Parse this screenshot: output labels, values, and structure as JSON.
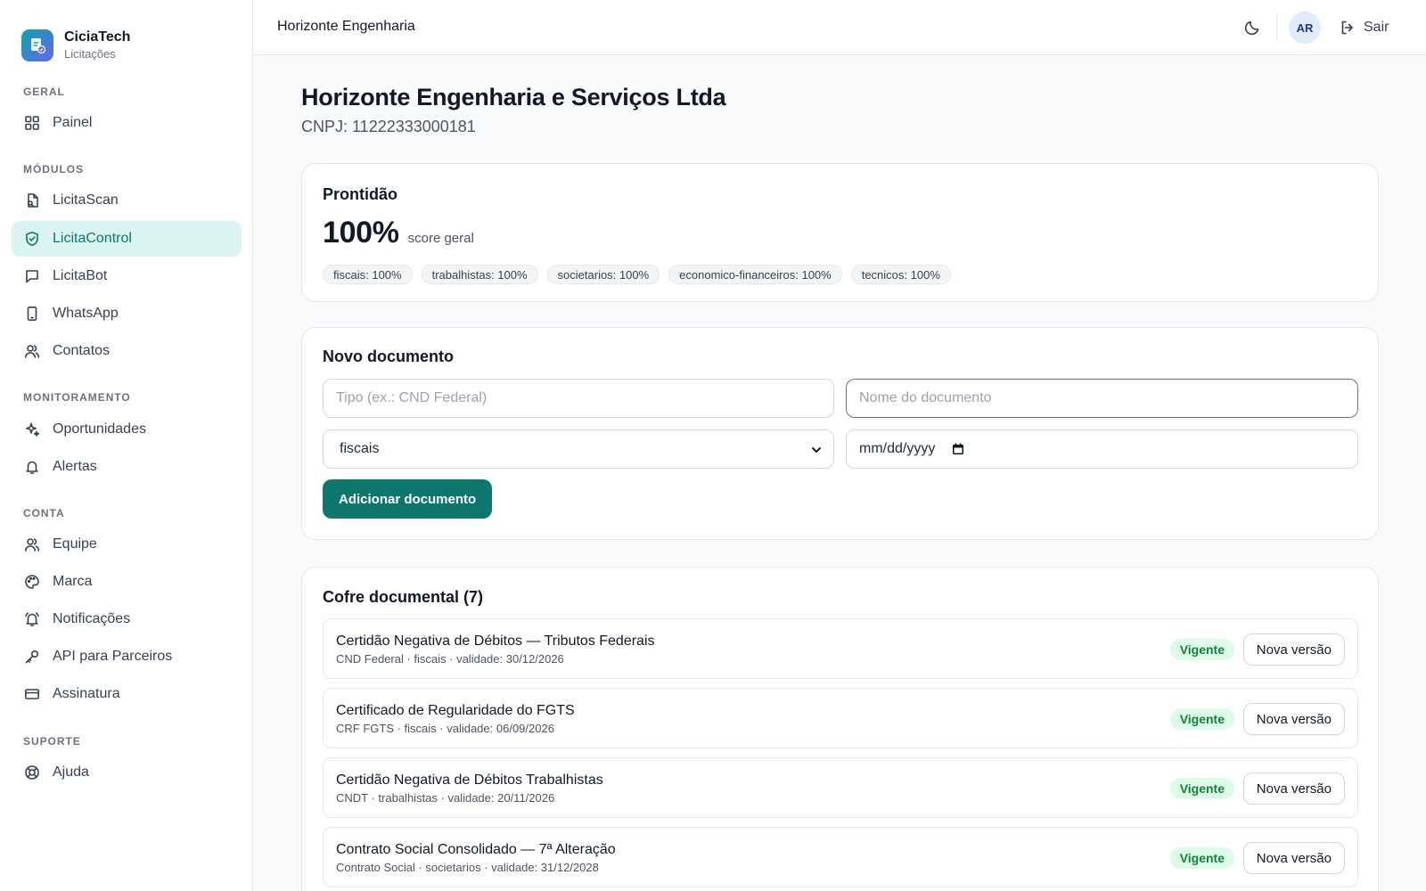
{
  "brand": {
    "name": "CiciaTech",
    "subtitle": "Licitações"
  },
  "sidebar": {
    "sections": [
      {
        "label": "GERAL"
      },
      {
        "label": "MÓDULOS"
      },
      {
        "label": "MONITORAMENTO"
      },
      {
        "label": "CONTA"
      },
      {
        "label": "SUPORTE"
      }
    ],
    "items": [
      {
        "label": "Painel",
        "icon": "grid-icon",
        "active": false
      },
      {
        "label": "LicitaScan",
        "icon": "file-scan-icon",
        "active": false
      },
      {
        "label": "LicitaControl",
        "icon": "shield-check-icon",
        "active": true
      },
      {
        "label": "LicitaBot",
        "icon": "chat-icon",
        "active": false
      },
      {
        "label": "WhatsApp",
        "icon": "phone-icon",
        "active": false
      },
      {
        "label": "Contatos",
        "icon": "users-icon",
        "active": false
      },
      {
        "label": "Oportunidades",
        "icon": "sparkles-icon",
        "active": false
      },
      {
        "label": "Alertas",
        "icon": "bell-icon",
        "active": false
      },
      {
        "label": "Equipe",
        "icon": "users-icon",
        "active": false
      },
      {
        "label": "Marca",
        "icon": "palette-icon",
        "active": false
      },
      {
        "label": "Notificações",
        "icon": "bell-ring-icon",
        "active": false
      },
      {
        "label": "API para Parceiros",
        "icon": "key-icon",
        "active": false
      },
      {
        "label": "Assinatura",
        "icon": "credit-card-icon",
        "active": false
      },
      {
        "label": "Ajuda",
        "icon": "lifebuoy-icon",
        "active": false
      }
    ]
  },
  "header": {
    "title": "Horizonte Engenharia",
    "avatar_initials": "AR",
    "logout_label": "Sair"
  },
  "company": {
    "name": "Horizonte Engenharia e Serviços Ltda",
    "cnpj": "CNPJ: 11222333000181"
  },
  "readiness": {
    "title": "Prontidão",
    "score": "100%",
    "score_label": "score geral",
    "chips": [
      "fiscais: 100%",
      "trabalhistas: 100%",
      "societarios: 100%",
      "economico-financeiros: 100%",
      "tecnicos: 100%"
    ]
  },
  "new_doc": {
    "title": "Novo documento",
    "type_placeholder": "Tipo (ex.: CND Federal)",
    "name_placeholder": "Nome do documento",
    "category_value": "fiscais",
    "date_placeholder": "mm/dd/yyyy",
    "submit_label": "Adicionar documento"
  },
  "vault": {
    "title": "Cofre documental (7)",
    "status_color": "#15803d",
    "docs": [
      {
        "title": "Certidão Negativa de Débitos — Tributos Federais",
        "meta": "CND Federal · fiscais · validade: 30/12/2026",
        "status": "Vigente",
        "action": "Nova versão"
      },
      {
        "title": "Certificado de Regularidade do FGTS",
        "meta": "CRF FGTS · fiscais · validade: 06/09/2026",
        "status": "Vigente",
        "action": "Nova versão"
      },
      {
        "title": "Certidão Negativa de Débitos Trabalhistas",
        "meta": "CNDT · trabalhistas · validade: 20/11/2026",
        "status": "Vigente",
        "action": "Nova versão"
      },
      {
        "title": "Contrato Social Consolidado — 7ª Alteração",
        "meta": "Contrato Social · societarios · validade: 31/12/2028",
        "status": "Vigente",
        "action": "Nova versão"
      }
    ]
  },
  "colors": {
    "accent": "#0f766e",
    "active_bg": "#d9f4f1"
  }
}
